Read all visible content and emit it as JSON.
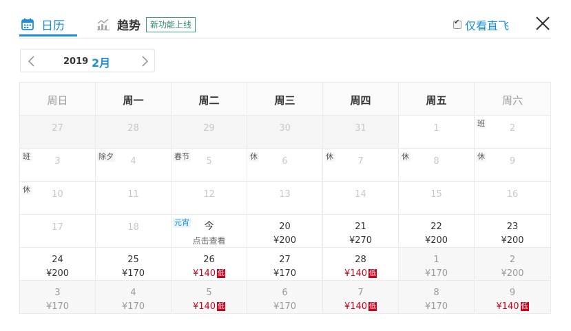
{
  "tabs": {
    "calendar_label": "日历",
    "trend_label": "趋势",
    "new_badge": "新功能上线"
  },
  "filter": {
    "direct_only_label": "仅看直飞",
    "direct_only_checked": true
  },
  "month_nav": {
    "year": "2019",
    "month": "2月"
  },
  "colors": {
    "accent": "#1a8fd8",
    "low_price": "#d0021b",
    "badge_border": "#3aa07c"
  },
  "weekdays": [
    "周日",
    "周一",
    "周二",
    "周三",
    "周四",
    "周五",
    "周六"
  ],
  "weeks": [
    [
      {
        "day": "27",
        "past": true
      },
      {
        "day": "28",
        "past": true
      },
      {
        "day": "29",
        "past": true
      },
      {
        "day": "30",
        "past": true
      },
      {
        "day": "31",
        "past": true
      },
      {
        "day": "1",
        "faded": true
      },
      {
        "day": "2",
        "faded": true,
        "tag": "班"
      }
    ],
    [
      {
        "day": "3",
        "faded": true,
        "tag": "班"
      },
      {
        "day": "4",
        "faded": true,
        "tag": "除夕"
      },
      {
        "day": "5",
        "faded": true,
        "tag": "春节"
      },
      {
        "day": "6",
        "faded": true,
        "tag": "休"
      },
      {
        "day": "7",
        "faded": true,
        "tag": "休"
      },
      {
        "day": "8",
        "faded": true,
        "tag": "休"
      },
      {
        "day": "9",
        "faded": true,
        "tag": "休"
      }
    ],
    [
      {
        "day": "10",
        "faded": true,
        "tag": "休"
      },
      {
        "day": "11",
        "faded": true
      },
      {
        "day": "12",
        "faded": true
      },
      {
        "day": "13",
        "faded": true
      },
      {
        "day": "14",
        "faded": true
      },
      {
        "day": "15",
        "faded": true
      },
      {
        "day": "16",
        "faded": true
      }
    ],
    [
      {
        "day": "17",
        "faded": true
      },
      {
        "day": "18",
        "faded": true
      },
      {
        "day": "今",
        "today": true,
        "tag": "元宵",
        "tag_blue": true,
        "hint": "点击查看"
      },
      {
        "day": "20",
        "price": "¥200"
      },
      {
        "day": "21",
        "price": "¥270"
      },
      {
        "day": "22",
        "price": "¥200"
      },
      {
        "day": "23",
        "price": "¥200"
      }
    ],
    [
      {
        "day": "24",
        "price": "¥200"
      },
      {
        "day": "25",
        "price": "¥170"
      },
      {
        "day": "26",
        "price": "¥140",
        "low": true
      },
      {
        "day": "27",
        "price": "¥170"
      },
      {
        "day": "28",
        "price": "¥140",
        "low": true
      },
      {
        "day": "1",
        "price": "¥170",
        "grey": true
      },
      {
        "day": "2",
        "price": "¥200",
        "grey": true
      }
    ],
    [
      {
        "day": "3",
        "price": "¥170",
        "grey": true
      },
      {
        "day": "4",
        "price": "¥170",
        "grey": true
      },
      {
        "day": "5",
        "price": "¥140",
        "low": true,
        "grey": true
      },
      {
        "day": "6",
        "price": "¥170",
        "grey": true
      },
      {
        "day": "7",
        "price": "¥140",
        "low": true,
        "grey": true
      },
      {
        "day": "8",
        "price": "¥170",
        "grey": true
      },
      {
        "day": "9",
        "price": "¥140",
        "low": true,
        "grey": true
      }
    ]
  ],
  "low_badge_text": "低"
}
